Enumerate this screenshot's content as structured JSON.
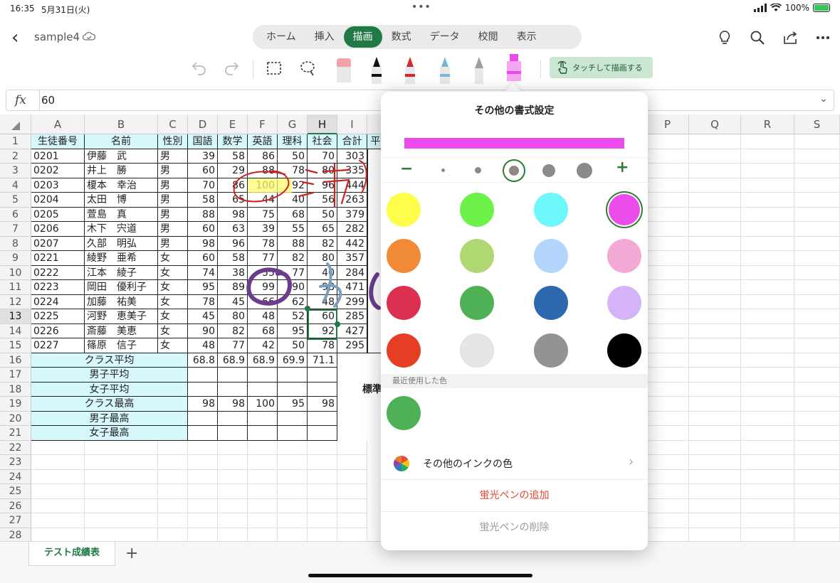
{
  "status": {
    "time": "16:35",
    "date": "5月31日(火)",
    "battery": "100%"
  },
  "app": {
    "filename": "sample4"
  },
  "tabs": [
    "ホーム",
    "挿入",
    "描画",
    "数式",
    "データ",
    "校閲",
    "表示"
  ],
  "ribbon": {
    "touch_draw": "タッチして描画する"
  },
  "formula": {
    "fx": "fx",
    "value": "60"
  },
  "columns": [
    "A",
    "B",
    "C",
    "D",
    "E",
    "F",
    "G",
    "H",
    "I",
    "",
    "",
    "",
    "",
    "P",
    "Q",
    "R",
    "S"
  ],
  "rows": [
    "1",
    "2",
    "3",
    "4",
    "5",
    "6",
    "7",
    "8",
    "9",
    "10",
    "11",
    "12",
    "13",
    "14",
    "15",
    "16",
    "17",
    "18",
    "19",
    "20",
    "21",
    "22",
    "23",
    "24",
    "25",
    "26",
    "27",
    "28"
  ],
  "headers": [
    "生徒番号",
    "名前",
    "性別",
    "国語",
    "数学",
    "英語",
    "理科",
    "社会",
    "合計",
    "平"
  ],
  "students": [
    [
      "0201",
      "伊藤　武",
      "男",
      "39",
      "58",
      "86",
      "50",
      "70",
      "303"
    ],
    [
      "0202",
      "井上　勝",
      "男",
      "60",
      "29",
      "88",
      "78",
      "80",
      "335"
    ],
    [
      "0203",
      "榎本　幸治",
      "男",
      "70",
      "86",
      "100",
      "92",
      "96",
      "444"
    ],
    [
      "0204",
      "太田　博",
      "男",
      "58",
      "65",
      "44",
      "40",
      "56",
      "263"
    ],
    [
      "0205",
      "萱島　真",
      "男",
      "88",
      "98",
      "75",
      "68",
      "50",
      "379"
    ],
    [
      "0206",
      "木下　宍道",
      "男",
      "60",
      "63",
      "39",
      "55",
      "65",
      "282"
    ],
    [
      "0207",
      "久部　明弘",
      "男",
      "98",
      "96",
      "78",
      "88",
      "82",
      "442"
    ],
    [
      "0221",
      "綾野　亜希",
      "女",
      "60",
      "58",
      "77",
      "82",
      "80",
      "357"
    ],
    [
      "0222",
      "江本　綾子",
      "女",
      "74",
      "38",
      "55",
      "77",
      "40",
      "284"
    ],
    [
      "0223",
      "岡田　優利子",
      "女",
      "95",
      "89",
      "99",
      "90",
      "98",
      "471"
    ],
    [
      "0224",
      "加藤　祐美",
      "女",
      "78",
      "45",
      "66",
      "62",
      "48",
      "299"
    ],
    [
      "0225",
      "河野　恵美子",
      "女",
      "45",
      "80",
      "48",
      "52",
      "60",
      "285"
    ],
    [
      "0226",
      "斎藤　美恵",
      "女",
      "90",
      "82",
      "68",
      "95",
      "92",
      "427"
    ],
    [
      "0227",
      "篠原　信子",
      "女",
      "48",
      "77",
      "42",
      "50",
      "78",
      "295"
    ]
  ],
  "summary": [
    {
      "label": "クラス平均",
      "values": [
        "68.8",
        "68.9",
        "68.9",
        "69.9",
        "71.1"
      ]
    },
    {
      "label": "男子平均",
      "values": [
        "",
        "",
        "",
        "",
        ""
      ]
    },
    {
      "label": "女子平均",
      "values": [
        "",
        "",
        "",
        "",
        ""
      ]
    },
    {
      "label": "クラス最高",
      "values": [
        "98",
        "98",
        "100",
        "95",
        "98"
      ]
    },
    {
      "label": "男子最高",
      "values": [
        "",
        "",
        "",
        "",
        ""
      ]
    },
    {
      "label": "女子最高",
      "values": [
        "",
        "",
        "",
        "",
        ""
      ]
    }
  ],
  "side_label": "標準",
  "sheet": {
    "tab": "テスト成績表",
    "add": "+"
  },
  "popover": {
    "title": "その他の書式設定",
    "preview_color": "#ea4bea",
    "minus": "−",
    "plus": "+",
    "colors": [
      "#fdfd4a",
      "#6cf24a",
      "#6ef8fc",
      "#ea4bea",
      "#f08a37",
      "#b0d872",
      "#b3d4fb",
      "#f3a9d3",
      "#dc3050",
      "#4fb155",
      "#2e68ae",
      "#d4b3f8",
      "#e63d25",
      "#e6e6e6",
      "#939393",
      "#000000"
    ],
    "selected_color_index": 3,
    "recent_label": "最近使用した色",
    "recent_colors": [
      "#4fb155"
    ],
    "more_colors": "その他のインクの色",
    "add_highlighter": "蛍光ペンの追加",
    "remove_highlighter": "蛍光ペンの削除",
    "accent_red": "#e2492f",
    "muted": "#9a9a9a"
  }
}
